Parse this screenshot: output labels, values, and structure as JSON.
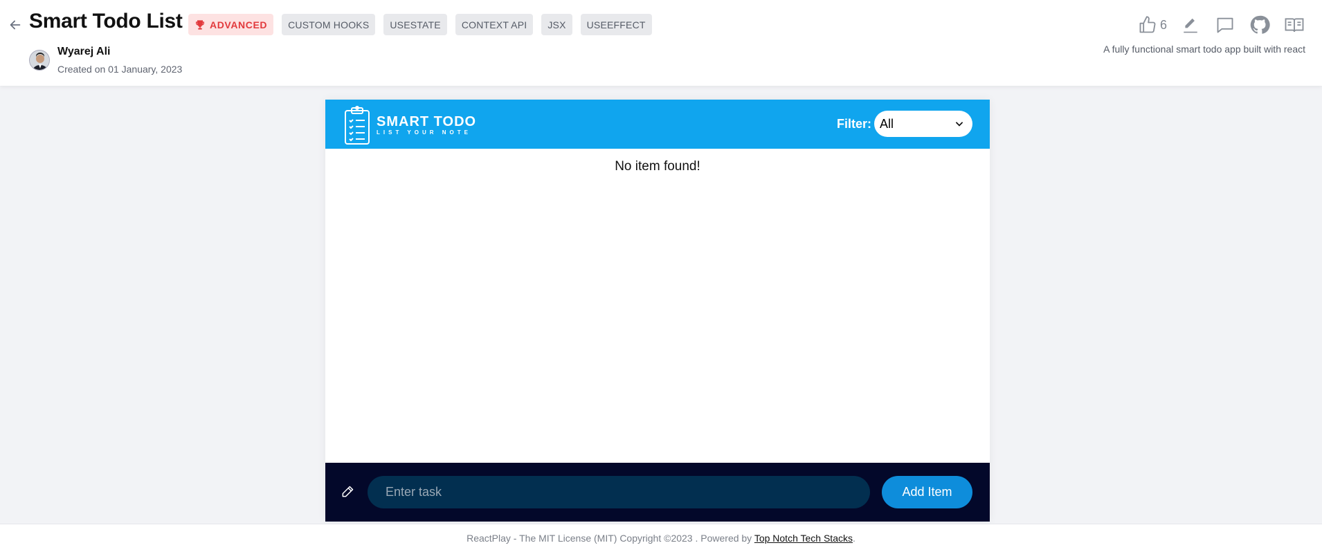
{
  "header": {
    "title": "Smart Todo List",
    "level": "ADVANCED",
    "tags": [
      "CUSTOM HOOKS",
      "USESTATE",
      "CONTEXT API",
      "JSX",
      "USEEFFECT"
    ],
    "author": "Wyarej Ali",
    "created": "Created on 01 January, 2023",
    "likes": "6",
    "description": "A fully functional smart todo app built with react"
  },
  "app": {
    "logo_title": "SMART TODO",
    "logo_subtitle": "LIST YOUR NOTE",
    "filter_label": "Filter:",
    "filter_value": "All",
    "empty_message": "No item found!",
    "input_placeholder": "Enter task",
    "add_button": "Add Item"
  },
  "footer": {
    "text": "ReactPlay - The MIT License (MIT) Copyright ©2023 . Powered by ",
    "link": "Top Notch Tech Stacks",
    "end": "."
  },
  "colors": {
    "app_bar": "#10a5ee",
    "input_bar": "#03082a",
    "add_button": "#0e8ddb",
    "level_badge": "#e2393c"
  },
  "icons": [
    "back-arrow-icon",
    "trophy-icon",
    "thumbs-up-icon",
    "pencil-icon",
    "comment-icon",
    "github-icon",
    "book-icon",
    "clipboard-icon",
    "chevron-down-icon"
  ]
}
